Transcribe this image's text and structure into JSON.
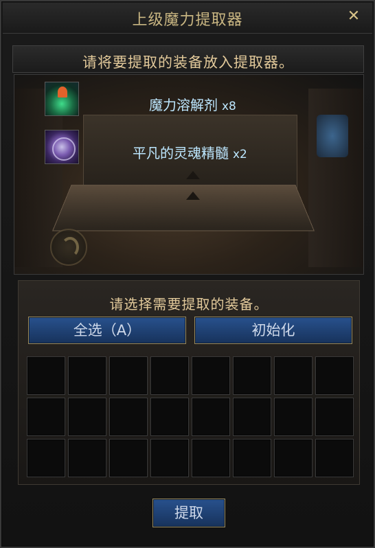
{
  "window": {
    "title": "上级魔力提取器",
    "close_icon": "close-icon"
  },
  "instruction": "请将要提取的装备放入提取器。",
  "items": [
    {
      "name": "魔力溶解剂",
      "quantity": "x8",
      "icon": "potion-icon"
    },
    {
      "name": "平凡的灵魂精髓",
      "quantity": "x2",
      "icon": "soul-essence-icon"
    }
  ],
  "selection": {
    "label": "请选择需要提取的装备。",
    "select_all_label": "全选（A）",
    "reset_label": "初始化",
    "slots": {
      "rows": 3,
      "cols": 8
    }
  },
  "extract_label": "提取",
  "colors": {
    "gold_text": "#e2c99a",
    "item_text": "#bde7ff",
    "button_blue": "#28518d"
  }
}
